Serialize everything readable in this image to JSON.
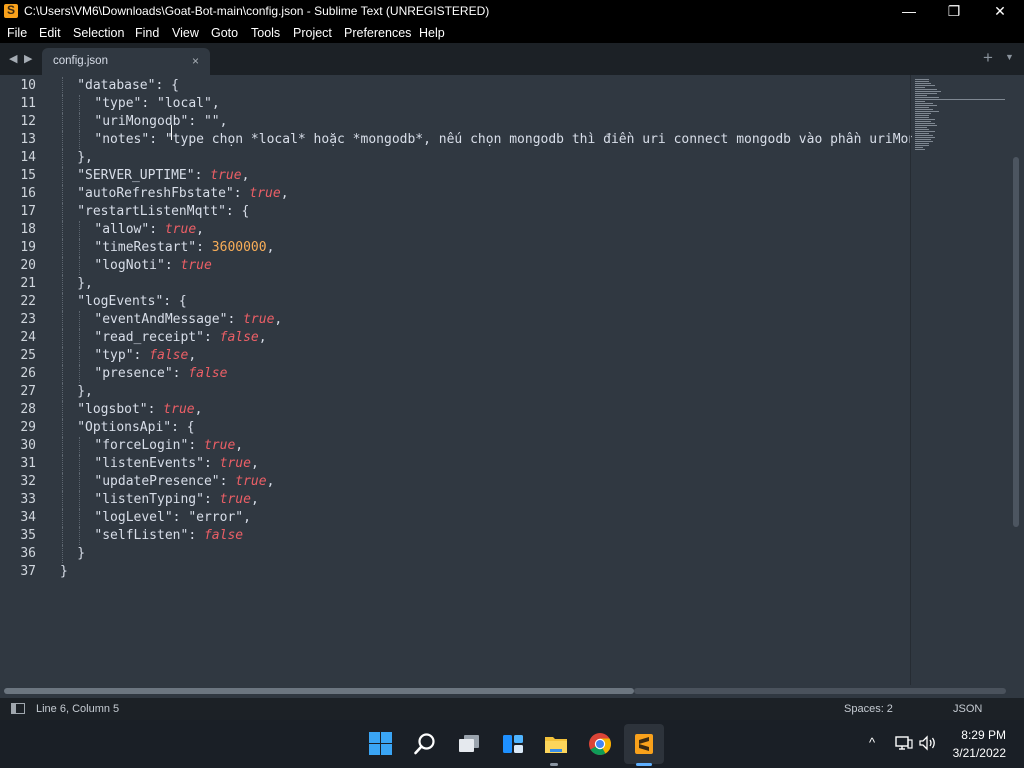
{
  "window": {
    "title": "C:\\Users\\VM6\\Downloads\\Goat-Bot-main\\config.json - Sublime Text (UNREGISTERED)",
    "minimize_glyph": "—",
    "maximize_glyph": "❐",
    "close_glyph": "✕"
  },
  "menu": {
    "file": "File",
    "edit": "Edit",
    "selection": "Selection",
    "find": "Find",
    "view": "View",
    "goto": "Goto",
    "tools": "Tools",
    "project": "Project",
    "preferences": "Preferences",
    "help": "Help"
  },
  "tabs": {
    "back_glyph": "◀",
    "forward_glyph": "▶",
    "active_label": "config.json",
    "close_glyph": "×",
    "add_glyph": "+",
    "menu_glyph": "▼"
  },
  "editor": {
    "lines": [
      {
        "n": "10",
        "indent": 1,
        "tokens": [
          {
            "t": "\"database\"",
            "c": "str"
          },
          {
            "t": ": {",
            "c": "punct"
          }
        ]
      },
      {
        "n": "11",
        "indent": 2,
        "tokens": [
          {
            "t": "\"type\"",
            "c": "str"
          },
          {
            "t": ": ",
            "c": "punct"
          },
          {
            "t": "\"local\"",
            "c": "str"
          },
          {
            "t": ",",
            "c": "punct"
          }
        ]
      },
      {
        "n": "12",
        "indent": 2,
        "tokens": [
          {
            "t": "\"uriMongodb\"",
            "c": "str"
          },
          {
            "t": ": ",
            "c": "punct"
          },
          {
            "t": "\"\"",
            "c": "str"
          },
          {
            "t": ",",
            "c": "punct"
          }
        ]
      },
      {
        "n": "13",
        "indent": 2,
        "tokens": [
          {
            "t": "\"notes\"",
            "c": "str"
          },
          {
            "t": ": ",
            "c": "punct"
          },
          {
            "t": "\"type chọn *local* hoặc *mongodb*, nếu chọn mongodb thì điền uri connect mongodb vào phần uriMongodb\"",
            "c": "str"
          }
        ]
      },
      {
        "n": "14",
        "indent": 1,
        "tokens": [
          {
            "t": "},",
            "c": "punct"
          }
        ]
      },
      {
        "n": "15",
        "indent": 1,
        "tokens": [
          {
            "t": "\"SERVER_UPTIME\"",
            "c": "str"
          },
          {
            "t": ": ",
            "c": "punct"
          },
          {
            "t": "true",
            "c": "bool"
          },
          {
            "t": ",",
            "c": "punct"
          }
        ]
      },
      {
        "n": "16",
        "indent": 1,
        "tokens": [
          {
            "t": "\"autoRefreshFbstate\"",
            "c": "str"
          },
          {
            "t": ": ",
            "c": "punct"
          },
          {
            "t": "true",
            "c": "bool"
          },
          {
            "t": ",",
            "c": "punct"
          }
        ]
      },
      {
        "n": "17",
        "indent": 1,
        "tokens": [
          {
            "t": "\"restartListenMqtt\"",
            "c": "str"
          },
          {
            "t": ": {",
            "c": "punct"
          }
        ]
      },
      {
        "n": "18",
        "indent": 2,
        "tokens": [
          {
            "t": "\"allow\"",
            "c": "str"
          },
          {
            "t": ": ",
            "c": "punct"
          },
          {
            "t": "true",
            "c": "bool"
          },
          {
            "t": ",",
            "c": "punct"
          }
        ]
      },
      {
        "n": "19",
        "indent": 2,
        "tokens": [
          {
            "t": "\"timeRestart\"",
            "c": "str"
          },
          {
            "t": ": ",
            "c": "punct"
          },
          {
            "t": "3600000",
            "c": "num"
          },
          {
            "t": ",",
            "c": "punct"
          }
        ]
      },
      {
        "n": "20",
        "indent": 2,
        "tokens": [
          {
            "t": "\"logNoti\"",
            "c": "str"
          },
          {
            "t": ": ",
            "c": "punct"
          },
          {
            "t": "true",
            "c": "bool"
          }
        ]
      },
      {
        "n": "21",
        "indent": 1,
        "tokens": [
          {
            "t": "},",
            "c": "punct"
          }
        ]
      },
      {
        "n": "22",
        "indent": 1,
        "tokens": [
          {
            "t": "\"logEvents\"",
            "c": "str"
          },
          {
            "t": ": {",
            "c": "punct"
          }
        ]
      },
      {
        "n": "23",
        "indent": 2,
        "tokens": [
          {
            "t": "\"eventAndMessage\"",
            "c": "str"
          },
          {
            "t": ": ",
            "c": "punct"
          },
          {
            "t": "true",
            "c": "bool"
          },
          {
            "t": ",",
            "c": "punct"
          }
        ]
      },
      {
        "n": "24",
        "indent": 2,
        "tokens": [
          {
            "t": "\"read_receipt\"",
            "c": "str"
          },
          {
            "t": ": ",
            "c": "punct"
          },
          {
            "t": "false",
            "c": "bool"
          },
          {
            "t": ",",
            "c": "punct"
          }
        ]
      },
      {
        "n": "25",
        "indent": 2,
        "tokens": [
          {
            "t": "\"typ\"",
            "c": "str"
          },
          {
            "t": ": ",
            "c": "punct"
          },
          {
            "t": "false",
            "c": "bool"
          },
          {
            "t": ",",
            "c": "punct"
          }
        ]
      },
      {
        "n": "26",
        "indent": 2,
        "tokens": [
          {
            "t": "\"presence\"",
            "c": "str"
          },
          {
            "t": ": ",
            "c": "punct"
          },
          {
            "t": "false",
            "c": "bool"
          }
        ]
      },
      {
        "n": "27",
        "indent": 1,
        "tokens": [
          {
            "t": "},",
            "c": "punct"
          }
        ]
      },
      {
        "n": "28",
        "indent": 1,
        "tokens": [
          {
            "t": "\"logsbot\"",
            "c": "str"
          },
          {
            "t": ": ",
            "c": "punct"
          },
          {
            "t": "true",
            "c": "bool"
          },
          {
            "t": ",",
            "c": "punct"
          }
        ]
      },
      {
        "n": "29",
        "indent": 1,
        "tokens": [
          {
            "t": "\"OptionsApi\"",
            "c": "str"
          },
          {
            "t": ": {",
            "c": "punct"
          }
        ]
      },
      {
        "n": "30",
        "indent": 2,
        "tokens": [
          {
            "t": "\"forceLogin\"",
            "c": "str"
          },
          {
            "t": ": ",
            "c": "punct"
          },
          {
            "t": "true",
            "c": "bool"
          },
          {
            "t": ",",
            "c": "punct"
          }
        ]
      },
      {
        "n": "31",
        "indent": 2,
        "tokens": [
          {
            "t": "\"listenEvents\"",
            "c": "str"
          },
          {
            "t": ": ",
            "c": "punct"
          },
          {
            "t": "true",
            "c": "bool"
          },
          {
            "t": ",",
            "c": "punct"
          }
        ]
      },
      {
        "n": "32",
        "indent": 2,
        "tokens": [
          {
            "t": "\"updatePresence\"",
            "c": "str"
          },
          {
            "t": ": ",
            "c": "punct"
          },
          {
            "t": "true",
            "c": "bool"
          },
          {
            "t": ",",
            "c": "punct"
          }
        ]
      },
      {
        "n": "33",
        "indent": 2,
        "tokens": [
          {
            "t": "\"listenTyping\"",
            "c": "str"
          },
          {
            "t": ": ",
            "c": "punct"
          },
          {
            "t": "true",
            "c": "bool"
          },
          {
            "t": ",",
            "c": "punct"
          }
        ]
      },
      {
        "n": "34",
        "indent": 2,
        "tokens": [
          {
            "t": "\"logLevel\"",
            "c": "str"
          },
          {
            "t": ": ",
            "c": "punct"
          },
          {
            "t": "\"error\"",
            "c": "str"
          },
          {
            "t": ",",
            "c": "punct"
          }
        ]
      },
      {
        "n": "35",
        "indent": 2,
        "tokens": [
          {
            "t": "\"selfListen\"",
            "c": "str"
          },
          {
            "t": ": ",
            "c": "punct"
          },
          {
            "t": "false",
            "c": "bool"
          }
        ]
      },
      {
        "n": "36",
        "indent": 1,
        "tokens": [
          {
            "t": "}",
            "c": "punct"
          }
        ]
      },
      {
        "n": "37",
        "indent": 0,
        "tokens": [
          {
            "t": "}",
            "c": "punct"
          }
        ]
      }
    ]
  },
  "status": {
    "position": "Line 6, Column 5",
    "indentation": "Spaces: 2",
    "syntax": "JSON"
  },
  "taskbar": {
    "time": "8:29 PM",
    "date": "3/21/2022",
    "tray_chevron": "^"
  },
  "colors": {
    "editor_bg": "#303841",
    "keyword_bool": "#ec5f66",
    "number": "#f9ae58",
    "text": "#d8dee9",
    "sublime_accent": "#f9a11b"
  }
}
